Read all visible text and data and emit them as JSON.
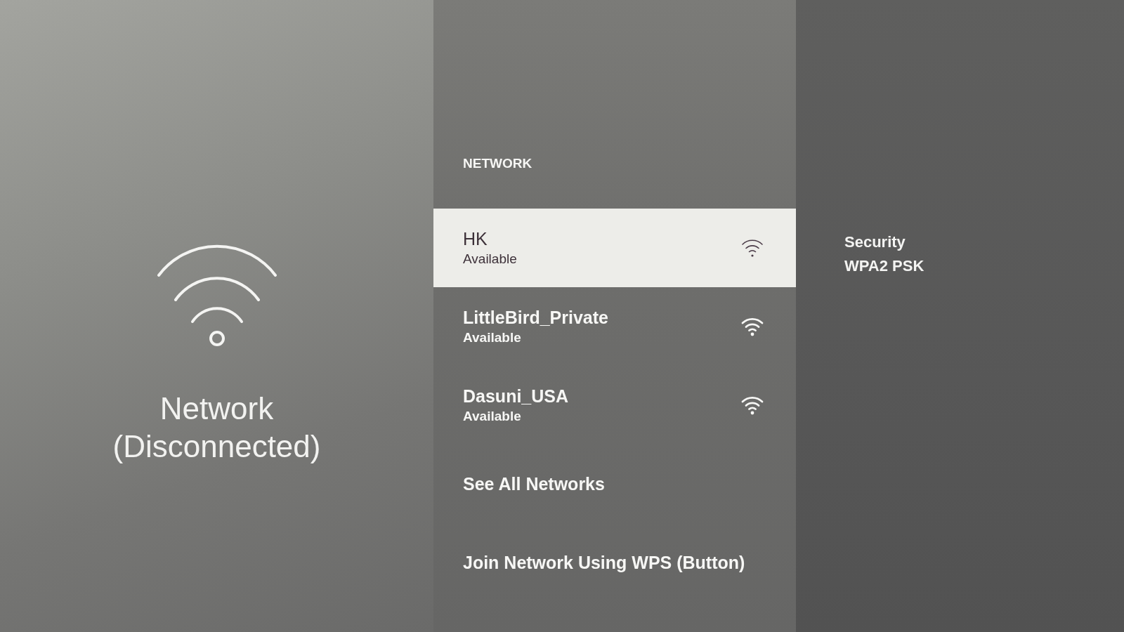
{
  "overview": {
    "title": "Network",
    "status": "(Disconnected)"
  },
  "menu": {
    "heading": "NETWORK",
    "items": [
      {
        "kind": "network",
        "name": "HK",
        "status": "Available",
        "selected": true
      },
      {
        "kind": "network",
        "name": "LittleBird_Private",
        "status": "Available",
        "selected": false
      },
      {
        "kind": "network",
        "name": "Dasuni_USA",
        "status": "Available",
        "selected": false
      },
      {
        "kind": "action",
        "label": "See All Networks",
        "selected": false
      },
      {
        "kind": "action",
        "label": "Join Network Using WPS (Button)",
        "selected": false
      }
    ]
  },
  "details": {
    "label": "Security",
    "value": "WPA2 PSK"
  }
}
